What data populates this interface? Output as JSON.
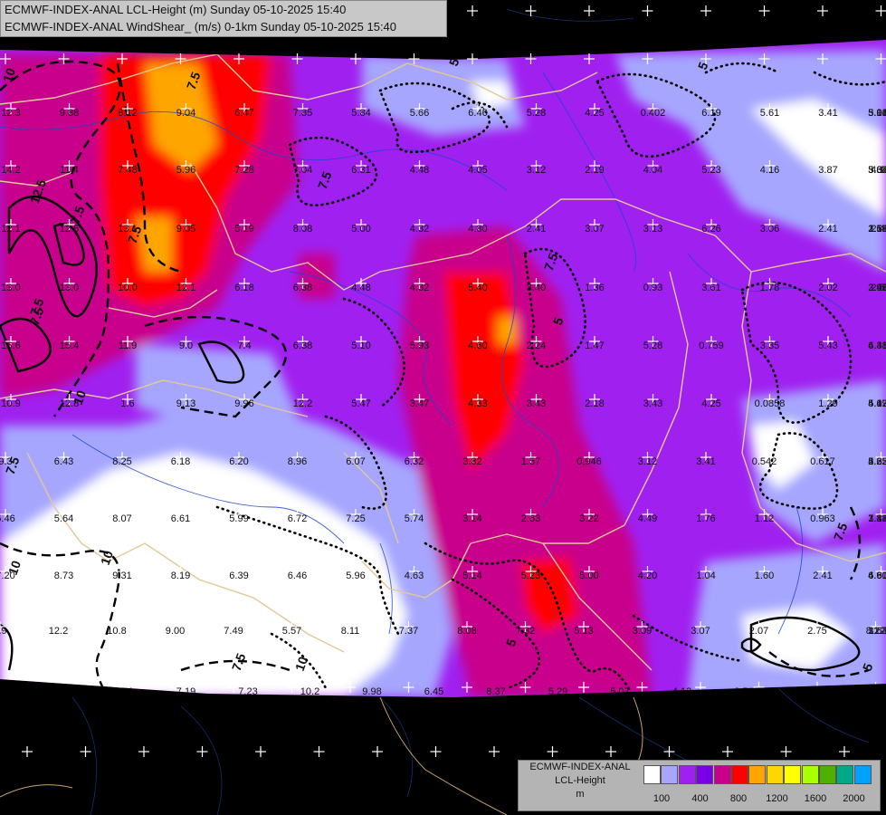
{
  "header": {
    "line1": "ECMWF-INDEX-ANAL LCL-Height (m) Sunday 05-10-2025 15:40",
    "line2": "ECMWF-INDEX-ANAL WindShear_ (m/s) 0-1km Sunday 05-10-2025 15:40"
  },
  "legend": {
    "title_line1": "ECMWF-INDEX-ANAL",
    "title_line2": "LCL-Height",
    "title_line3": "m",
    "colors": [
      "#ffffff",
      "#a6a6ff",
      "#a020f0",
      "#7a00e8",
      "#c8008c",
      "#ff0000",
      "#ffa500",
      "#ffd700",
      "#ffff00",
      "#aaff00",
      "#50b000",
      "#00aa88",
      "#00a0ff"
    ],
    "tick_labels": [
      "100",
      "400",
      "800",
      "1200",
      "1600",
      "2000"
    ]
  },
  "contour_labels": [
    "10",
    "7.5",
    "7.5",
    "12.5",
    "7.5",
    "10",
    "7.5",
    "10",
    "7.5",
    "10",
    "7.5",
    "10",
    "7.5",
    "7.5",
    "7.5",
    "7.5",
    "5",
    "5",
    "5",
    "5",
    "5"
  ],
  "grid_values": [
    [
      "12.3",
      "9.88",
      "8.12",
      "9.04",
      "6.47",
      "7.85",
      "5.84",
      "5.66",
      "6.46",
      "5.28",
      "4.25",
      "0.402",
      "6.19",
      "5.61",
      "3.41",
      "5.91",
      "5.14",
      "5.06",
      "3.03"
    ],
    [
      "14.2",
      "11.4",
      "7.48",
      "5.96",
      "7.28",
      "7.04",
      "6.31",
      "4.48",
      "4.05",
      "3.12",
      "2.19",
      "4.04",
      "5.23",
      "4.16",
      "3.87",
      "3.08",
      "3.67",
      "5.34",
      "4.1"
    ],
    [
      "12.1",
      "12.5",
      "13.1",
      "9.05",
      "5.19",
      "8.08",
      "5.00",
      "4.32",
      "4.80",
      "2.41",
      "3.07",
      "3.13",
      "6.26",
      "3.06",
      "2.41",
      "3.19",
      "2.54",
      "1.68",
      "2.4"
    ],
    [
      "13.0",
      "13.0",
      "10.0",
      "12.1",
      "6.18",
      "6.38",
      "4.48",
      "4.32",
      "5.40",
      "3.40",
      "1.36",
      "0.93",
      "3.61",
      "1.78",
      "2.02",
      "2.41",
      "3.98",
      "2.5"
    ],
    [
      "16.6",
      "15.4",
      "11.9",
      "9.0",
      "7.4",
      "6.38",
      "5.10",
      "5.93",
      "4.60",
      "2.24",
      "1.47",
      "5.28",
      "0.759",
      "3.35",
      "5.43",
      "6.31",
      "4.48"
    ],
    [
      "10.9",
      "12.8",
      "1.6",
      "9.13",
      "9.96",
      "12.2",
      "5.47",
      "3.47",
      "4.33",
      "3.43",
      "2.18",
      "3.43",
      "4.25",
      "0.0858",
      "1.29",
      "4.42",
      "5.09",
      "4.17"
    ],
    [
      "9.3",
      "6.43",
      "8.25",
      "6.18",
      "6.20",
      "8.96",
      "6.07",
      "6.32",
      "3.82",
      "1.57",
      "0.946",
      "3.12",
      "3.41",
      "0.542",
      "0.617",
      "2.22",
      "5.65",
      "4.32"
    ],
    [
      "5.46",
      "5.64",
      "8.07",
      "6.61",
      "5.99",
      "6.72",
      "7.25",
      "5.74",
      "3.14",
      "2.63",
      "3.22",
      "4.49",
      "1.76",
      "1.12",
      "0.963",
      "1.21",
      "3.88",
      "7.42"
    ],
    [
      "7.20",
      "8.73",
      "9.31",
      "8.19",
      "6.39",
      "6.46",
      "5.96",
      "4.63",
      "5.14",
      "5.23",
      "5.00",
      "4.20",
      "1.04",
      "1.60",
      "2.41",
      "4.60",
      "6.91",
      "4.60"
    ],
    [
      "9.9",
      "12.2",
      "10.8",
      "9.00",
      "7.49",
      "5.57",
      "8.11",
      "7.37",
      "8.08",
      "7.32",
      "5.13",
      "3.09",
      "3.07",
      "2.07",
      "2.75",
      "8.22",
      "3.64",
      "11.3"
    ],
    [
      "8",
      "12.5",
      "9.41",
      "7.19",
      "7.23",
      "10.2",
      "9.98",
      "6.45",
      "8.37",
      "5.29",
      "5.07",
      "4.13",
      "3.56",
      "3.10",
      "9.8"
    ]
  ]
}
